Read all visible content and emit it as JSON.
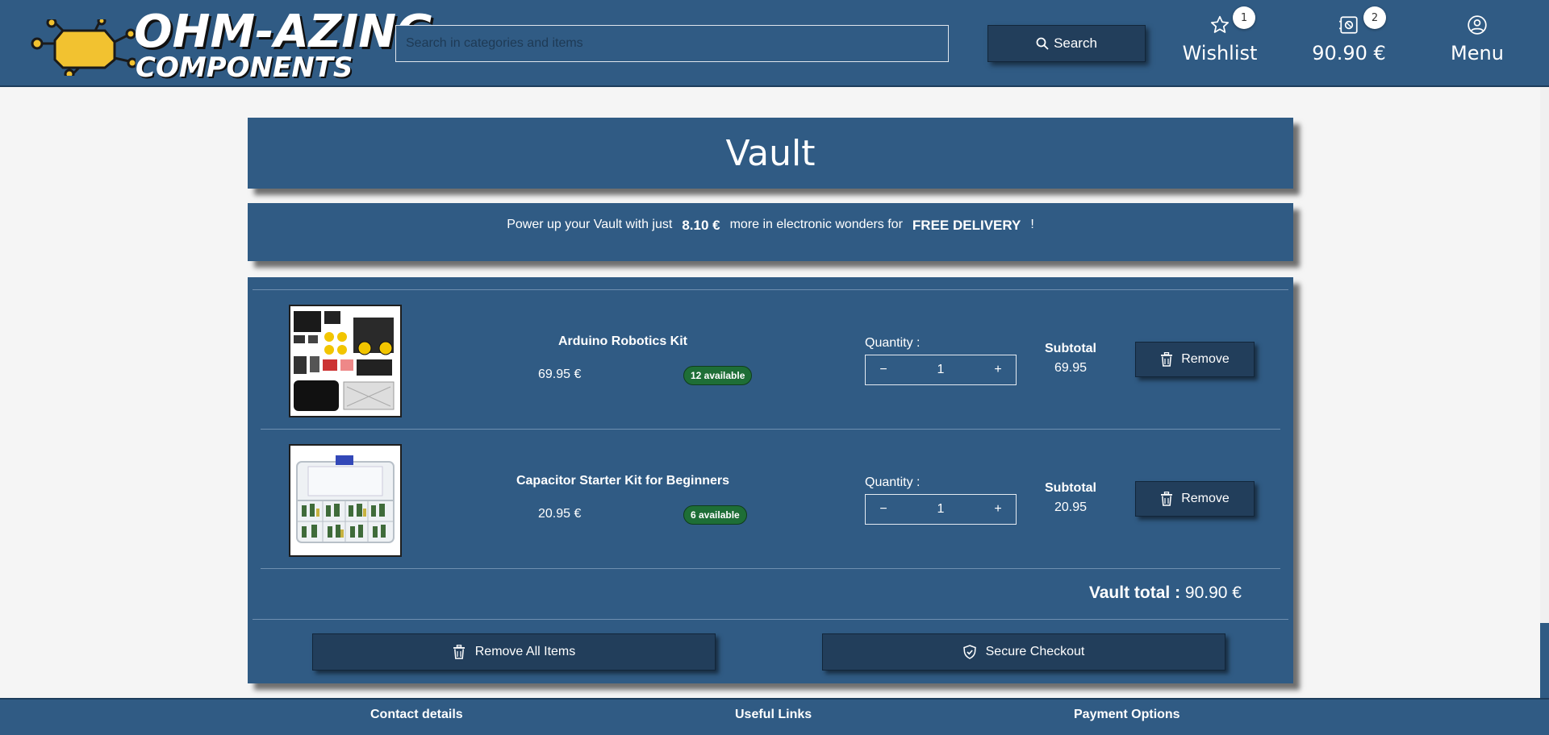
{
  "brand": {
    "line1": "OHM-AZING",
    "line2": "COMPONENTS",
    "chip_color": "#f2c230"
  },
  "header": {
    "search_placeholder": "Search in categories and items",
    "search_label": "Search",
    "wishlist_label": "Wishlist",
    "wishlist_count": "1",
    "cart_total": "90.90 €",
    "cart_count": "2",
    "menu_label": "Menu"
  },
  "page": {
    "title": "Vault"
  },
  "promo": {
    "prefix": "Power up your Vault with just",
    "amount": "8.10 €",
    "middle": "more in electronic wonders for",
    "highlight": "FREE DELIVERY",
    "suffix": "!"
  },
  "cart": {
    "items": [
      {
        "name": "Arduino Robotics Kit",
        "price": "69.95 €",
        "availability": "12 available",
        "quantity_label": "Quantity :",
        "quantity": "1",
        "minus": "−",
        "plus": "+",
        "subtotal_label": "Subtotal",
        "subtotal": "69.95",
        "remove_label": "Remove"
      },
      {
        "name": "Capacitor Starter Kit for Beginners",
        "price": "20.95 €",
        "availability": "6 available",
        "quantity_label": "Quantity :",
        "quantity": "1",
        "minus": "−",
        "plus": "+",
        "subtotal_label": "Subtotal",
        "subtotal": "20.95",
        "remove_label": "Remove"
      }
    ],
    "total_label": "Vault total :",
    "total_value": "90.90 €",
    "remove_all_label": "Remove All Items",
    "checkout_label": "Secure Checkout"
  },
  "footer": {
    "contact": "Contact details",
    "links": "Useful Links",
    "payment": "Payment Options"
  },
  "colors": {
    "primary": "#305b84",
    "button": "#223e5b",
    "badge_green": "#1e6e36",
    "background": "#f5f5f5"
  }
}
